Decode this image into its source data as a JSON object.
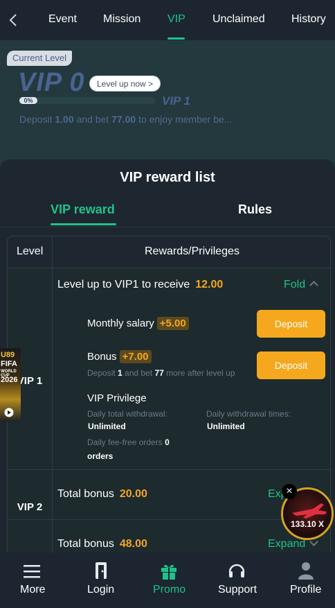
{
  "tabs": [
    "Event",
    "Mission",
    "VIP",
    "Unclaimed",
    "History"
  ],
  "active_tab": "VIP",
  "hero": {
    "current_level_label": "Current Level",
    "level": "VIP 0",
    "level_up_label": "Level up now >",
    "progress_text": "0%",
    "progress_fraction": 0.0,
    "next_level": "VIP 1",
    "desc_prefix": "Deposit ",
    "deposit_amount": "1.00",
    "desc_mid": " and bet ",
    "bet_amount": "77.00",
    "desc_suffix": " to enjoy member be..."
  },
  "panel": {
    "title": "VIP reward list",
    "tabs": [
      "VIP reward",
      "Rules"
    ],
    "active_tab": "VIP reward"
  },
  "table": {
    "headers": [
      "Level",
      "Rewards/Privileges"
    ],
    "vip1": {
      "level": "VIP 1",
      "title": "Level up to VIP1 to receive",
      "amount": "12.00",
      "toggle": "Fold",
      "monthly_label": "Monthly salary",
      "monthly_amount": "+5.00",
      "bonus_label": "Bonus",
      "bonus_amount": "+7.00",
      "deposit_button": "Deposit",
      "bonus_note_prefix": "Deposit ",
      "bonus_note_deposit": "1",
      "bonus_note_mid": " and bet ",
      "bonus_note_bet": "77",
      "bonus_note_suffix": " more after level up",
      "privilege_title": "VIP Privilege",
      "daily_withdrawal_label": "Daily total withdrawal:",
      "daily_withdrawal_value": "Unlimited",
      "daily_times_label": "Daily withdrawal times:",
      "daily_times_value": "Unlimited",
      "fee_free_label": "Daily fee-free orders",
      "fee_free_value": "0",
      "fee_free_unit": "orders"
    },
    "vip2": {
      "level": "VIP 2",
      "title": "Total bonus",
      "amount": "20.00",
      "toggle": "Expand"
    },
    "vip3": {
      "title": "Total bonus",
      "amount": "48.00",
      "toggle": "Expand"
    }
  },
  "promo_badge": {
    "lines": [
      "U89",
      "FIFA",
      "WORLD CUP",
      "2026"
    ]
  },
  "floating_game": {
    "multiplier": "133.10 X"
  },
  "bottom_nav": [
    "More",
    "Login",
    "Promo",
    "Support",
    "Profile"
  ],
  "bottom_nav_active": "Promo",
  "colors": {
    "accent": "#1fc38a",
    "amount": "#f5a623",
    "button": "#f5a81e"
  }
}
